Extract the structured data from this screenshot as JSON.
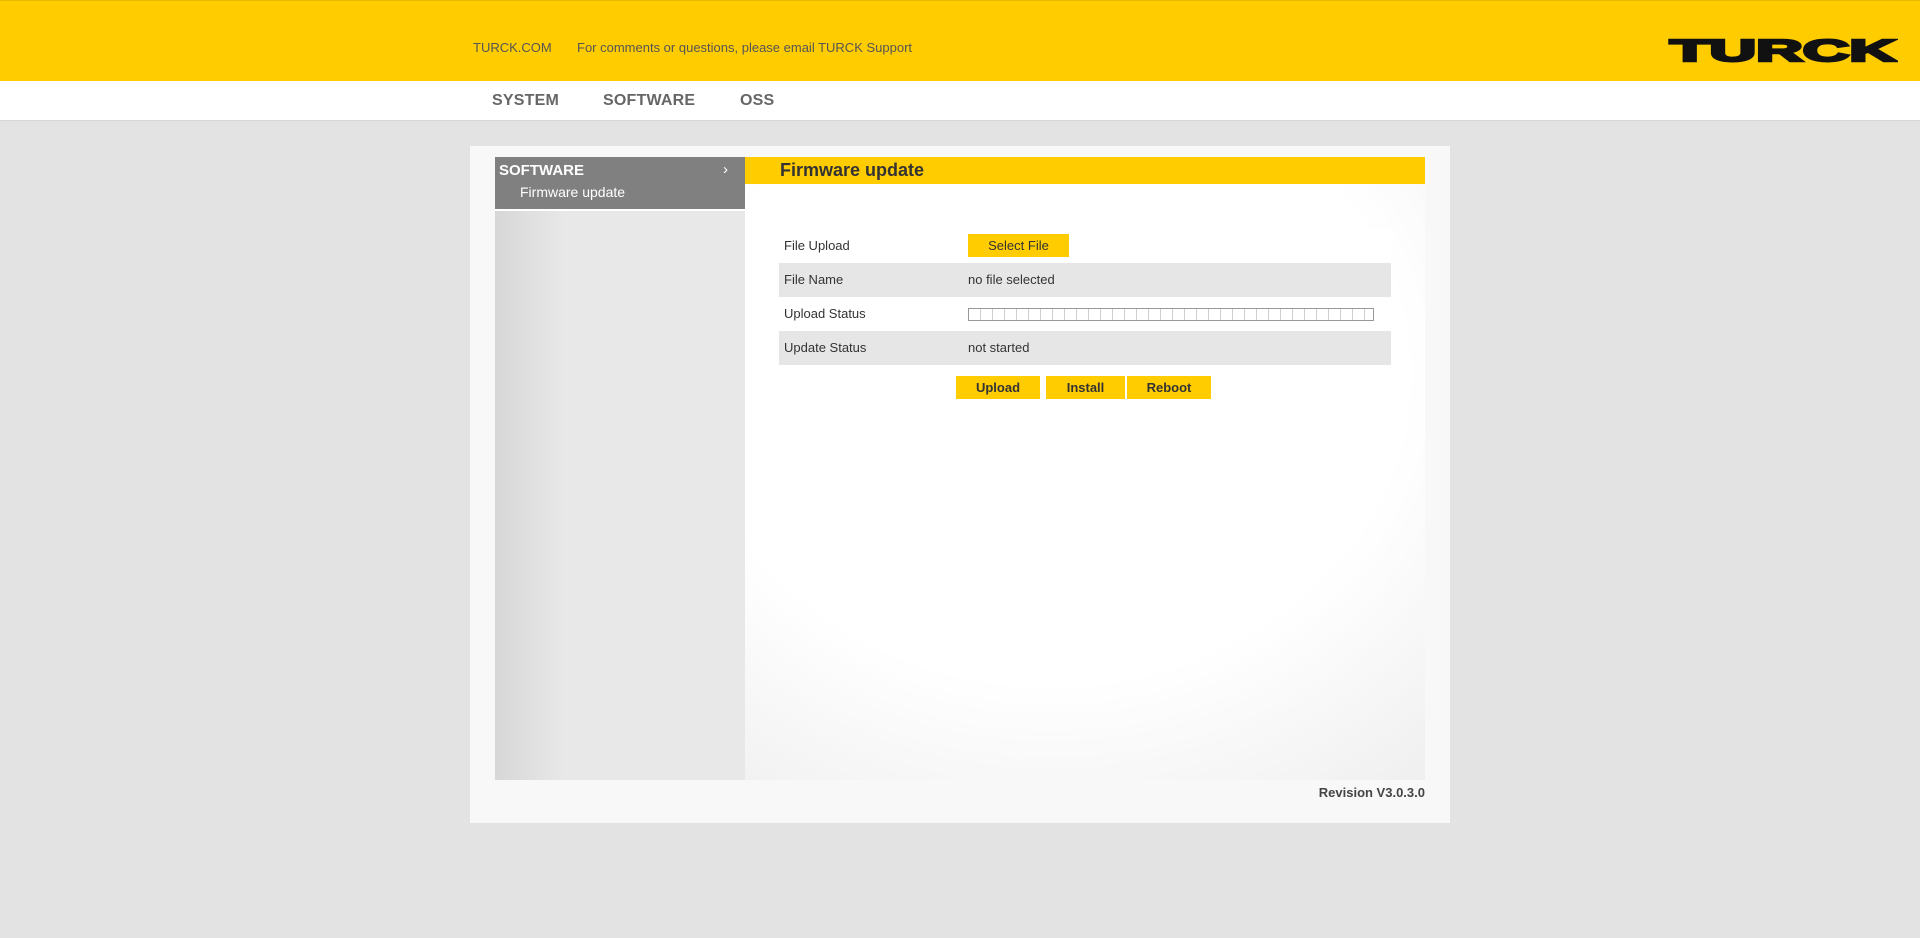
{
  "header": {
    "links": {
      "turck": "TURCK.COM",
      "support": "For comments or questions, please email TURCK Support"
    },
    "logo_text": "TURCK",
    "logo_icon": "turck-logo"
  },
  "nav": {
    "items": [
      {
        "label": "SYSTEM"
      },
      {
        "label": "SOFTWARE"
      },
      {
        "label": "OSS"
      }
    ]
  },
  "sidebar": {
    "title": "SOFTWARE",
    "chevron_icon": "chevron-right-icon",
    "chevron": "›",
    "items": [
      {
        "label": "Firmware update"
      }
    ]
  },
  "main": {
    "title": "Firmware update",
    "rows": {
      "file_upload": {
        "label": "File Upload",
        "button": "Select File"
      },
      "file_name": {
        "label": "File Name",
        "value": "no file selected"
      },
      "upload_status": {
        "label": "Upload Status",
        "progress": 0
      },
      "update_status": {
        "label": "Update Status",
        "value": "not started"
      }
    },
    "actions": {
      "upload": "Upload",
      "install": "Install",
      "reboot": "Reboot"
    }
  },
  "footer": {
    "revision": "Revision V3.0.3.0"
  },
  "colors": {
    "accent": "#ffcc00",
    "sidebar_header": "#808080",
    "background": "#e3e3e3",
    "row_alt": "#e6e6e6"
  }
}
